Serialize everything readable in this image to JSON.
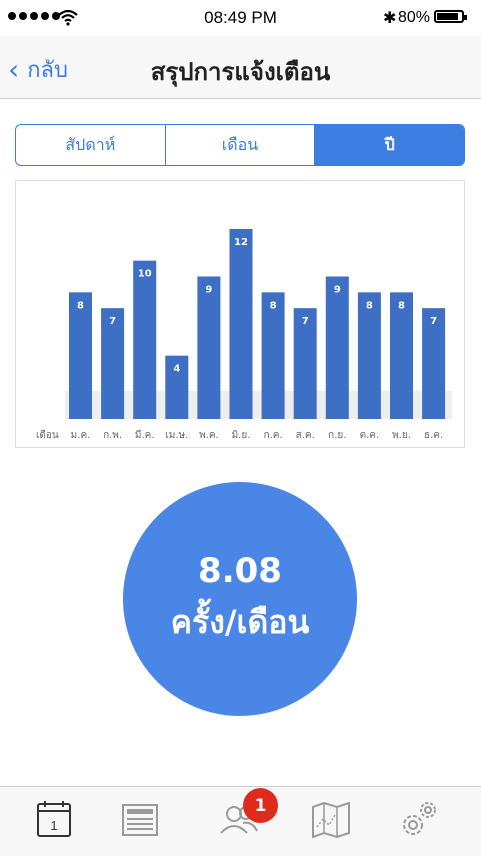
{
  "status_bar": {
    "time": "08:49 PM",
    "battery": "80%"
  },
  "nav": {
    "back_label": "กลับ",
    "title": "สรุปการแจ้งเตือน"
  },
  "segments": [
    {
      "label": "สัปดาห์",
      "active": false
    },
    {
      "label": "เดือน",
      "active": false
    },
    {
      "label": "ปี",
      "active": true
    }
  ],
  "chart_data": {
    "type": "bar",
    "axis_label": "เดือน",
    "categories": [
      "ม.ค.",
      "ก.พ.",
      "มี.ค.",
      "เม.ษ.",
      "พ.ค.",
      "มิ.ย.",
      "ก.ค.",
      "ส.ค.",
      "ก.ย.",
      "ต.ค.",
      "พ.ย.",
      "ธ.ค."
    ],
    "values": [
      8,
      7,
      10,
      4,
      9,
      12,
      8,
      7,
      9,
      8,
      8,
      7
    ],
    "ylim": [
      0,
      12
    ],
    "bar_color": "#3d6fc4",
    "grid": false
  },
  "summary": {
    "value": "8.08",
    "unit": "ครั้ง/เดือน",
    "color": "#4a86e6"
  },
  "tabbar": {
    "items": [
      {
        "icon": "calendar-icon",
        "text": "1"
      },
      {
        "icon": "news-icon"
      },
      {
        "icon": "users-icon"
      },
      {
        "icon": "map-icon"
      },
      {
        "icon": "settings-icon"
      }
    ],
    "badge": "1"
  }
}
